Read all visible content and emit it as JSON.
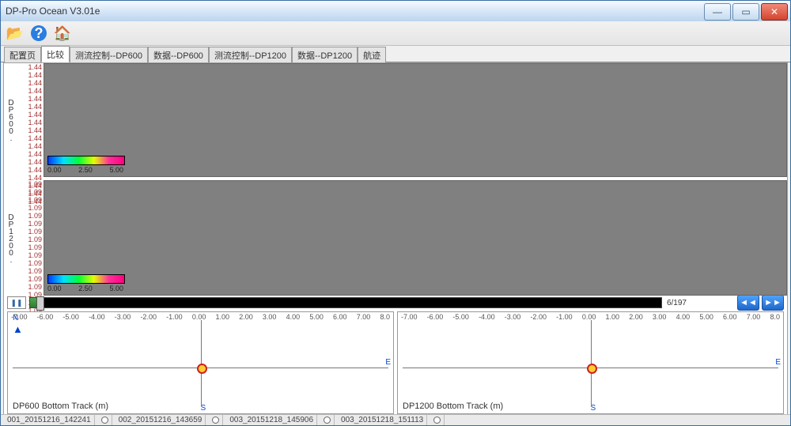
{
  "window": {
    "title": "DP-Pro Ocean V3.01e"
  },
  "tabs": [
    "配置页",
    "比较",
    "测流控制--DP600",
    "数据--DP600",
    "测流控制--DP1200",
    "数据--DP1200",
    "航迹"
  ],
  "active_tab_index": 1,
  "panels": [
    {
      "label": "DP600.",
      "y_value": "1.44",
      "tick_repeat": 18,
      "colorbar": {
        "min": "0.00",
        "mid": "2.50",
        "max": "5.00"
      }
    },
    {
      "label": "DP1200.",
      "y_value": "1.09",
      "tick_repeat": 20,
      "colorbar": {
        "min": "0.00",
        "mid": "2.50",
        "max": "5.00"
      }
    }
  ],
  "slider": {
    "position_label": "6/197"
  },
  "track_ticks": [
    "-7.00",
    "-6.00",
    "-5.00",
    "-4.00",
    "-3.00",
    "-2.00",
    "-1.00",
    "0.00",
    "1.00",
    "2.00",
    "3.00",
    "4.00",
    "5.00",
    "6.00",
    "7.00",
    "8.0"
  ],
  "tracks": [
    {
      "caption": "DP600 Bottom Track (m)",
      "N": "N",
      "E": "E",
      "S": "S"
    },
    {
      "caption": "DP1200 Bottom Track (m)",
      "N": "",
      "E": "E",
      "S": "S"
    }
  ],
  "status": [
    "001_20151216_142241",
    "",
    "002_20151216_143659",
    "",
    "003_20151218_145906",
    "",
    "003_20151218_151113",
    ""
  ],
  "chart_data": [
    {
      "type": "heatmap",
      "title": "DP600",
      "y_ticks_value": 1.44,
      "y_tick_count": 18,
      "colorbar_range": [
        0.0,
        5.0
      ],
      "data": null
    },
    {
      "type": "heatmap",
      "title": "DP1200",
      "y_ticks_value": 1.09,
      "y_tick_count": 20,
      "colorbar_range": [
        0.0,
        5.0
      ],
      "data": null
    },
    {
      "type": "scatter",
      "title": "DP600 Bottom Track (m)",
      "xlim": [
        -7.0,
        8.0
      ],
      "ylim": [
        -7.0,
        8.0
      ],
      "series": [
        {
          "name": "position",
          "x": [
            0.0
          ],
          "y": [
            0.0
          ]
        }
      ]
    },
    {
      "type": "scatter",
      "title": "DP1200 Bottom Track (m)",
      "xlim": [
        -7.0,
        8.0
      ],
      "ylim": [
        -7.0,
        8.0
      ],
      "series": [
        {
          "name": "position",
          "x": [
            0.0
          ],
          "y": [
            0.0
          ]
        }
      ]
    }
  ]
}
